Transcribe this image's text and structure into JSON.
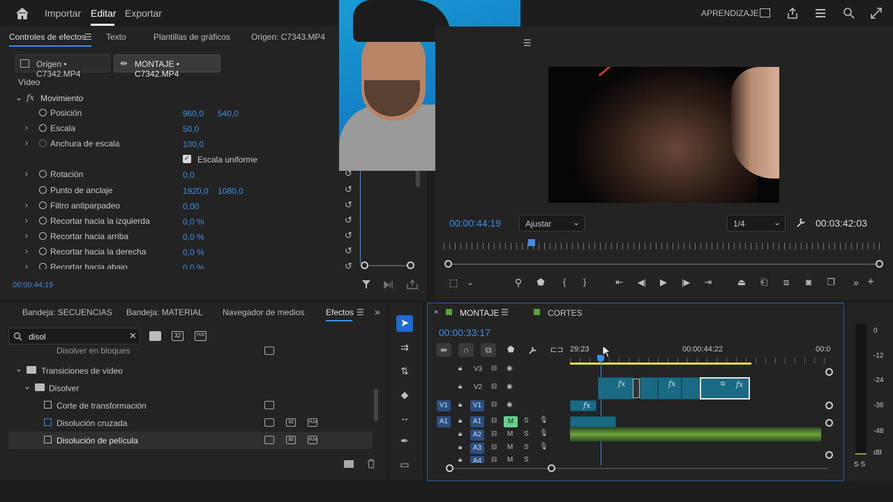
{
  "menu": {
    "import": "Importar",
    "edit": "Editar",
    "export": "Exportar",
    "learning": "APRENDIZAJE"
  },
  "effects_panel": {
    "tabs": [
      "Controles de efectos",
      "Texto",
      "Plantillas de gráficos",
      "Origen: C7343.MP4"
    ],
    "source_btn": "Origen • C7342.MP4",
    "montage_btn": "MONTAJE • C7342.MP4",
    "section_video": "Vídeo",
    "movement": "Movimiento",
    "fx_symbol": "fx",
    "uniform_scale": "Escala uniforme",
    "properties": [
      {
        "label": "Posición",
        "v1": "960,0",
        "v2": "540,0"
      },
      {
        "label": "Escala",
        "v1": "50,0",
        "v2": ""
      },
      {
        "label": "Anchura de escala",
        "v1": "100,0",
        "v2": ""
      },
      {
        "label": "Rotación",
        "v1": "0,0",
        "v2": ""
      },
      {
        "label": "Punto de anclaje",
        "v1": "1920,0",
        "v2": "1080,0"
      },
      {
        "label": "Filtro antiparpadeo",
        "v1": "0,00",
        "v2": ""
      },
      {
        "label": "Recortar hacia la izquierda",
        "v1": "0,0 %",
        "v2": ""
      },
      {
        "label": "Recortar hacia arriba",
        "v1": "0,0 %",
        "v2": ""
      },
      {
        "label": "Recortar hacia la derecha",
        "v1": "0,0 %",
        "v2": ""
      },
      {
        "label": "Recortar hacia abajo",
        "v1": "0,0 %",
        "v2": ""
      }
    ],
    "timecode": "00:00:44:19"
  },
  "program": {
    "timecode": "00:00:44:19",
    "fit": "Ajustar",
    "resolution": "1/4",
    "duration": "00:03:42:03"
  },
  "project": {
    "tabs": [
      "Bandeja: SECUENCIAS",
      "Bandeja: MATERIAL",
      "Navegador de medios",
      "Efectos"
    ],
    "search_value": "disol",
    "badges": [
      "32",
      "YUV"
    ],
    "items": [
      {
        "label": "Disolver en bloques"
      },
      {
        "label": "Transiciones de vídeo"
      },
      {
        "label": "Disolver"
      },
      {
        "label": "Corte de transformación"
      },
      {
        "label": "Disolución cruzada"
      },
      {
        "label": "Disolución de película"
      }
    ]
  },
  "timeline": {
    "tabs": [
      "MONTAJE",
      "CORTES"
    ],
    "timecode": "00:00:33:17",
    "ruler": [
      "29:23",
      "00:00:44:22",
      "00:0"
    ],
    "tracks": {
      "V3": "V3",
      "V2": "V2",
      "V1": "V1",
      "A1": "A1",
      "A2": "A2",
      "A3": "A3",
      "A4": "A4"
    },
    "mute": "M",
    "solo": "S"
  },
  "meter": {
    "labels": [
      "0",
      "-12",
      "-24",
      "-36",
      "-48",
      "dB"
    ],
    "footer": "S S"
  },
  "colors": {
    "accent": "#3f8fe6",
    "clip": "#1b6a84",
    "audio": "#6fa53d",
    "work_area": "#e7e43a",
    "mute_on": "#64d28a"
  }
}
